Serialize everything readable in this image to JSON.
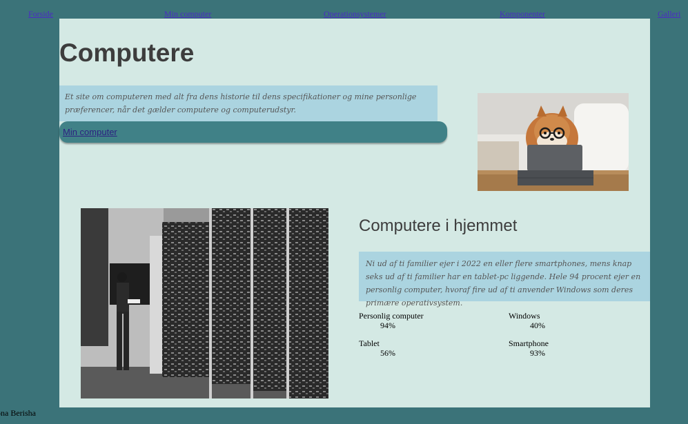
{
  "nav": {
    "items": [
      "Forside",
      "Min computer",
      "Operationsystemer",
      "Komponenter",
      "Galleri"
    ]
  },
  "header": {
    "title": "Computere",
    "intro": "Et site om computeren med alt fra dens historie til dens specifikationer og mine personlige præferencer, når det gælder computere og computerudstyr.",
    "link": "Min computer"
  },
  "section": {
    "title": "Computere i hjemmet",
    "text": "Ni ud af ti familier ejer i 2022 en eller flere smartphones, mens knap seks ud af ti familier har en tablet-pc liggende. Hele 94 procent ejer en personlig computer, hvoraf fire ud af ti anvender Windows som deres primære operativsystem.",
    "stats": [
      {
        "label": "Personlig computer",
        "value": "94%"
      },
      {
        "label": "Windows",
        "value": "40%"
      },
      {
        "label": "Tablet",
        "value": "56%"
      },
      {
        "label": "Smartphone",
        "value": "93%"
      }
    ]
  },
  "footer": {
    "text": "ona Berisha"
  },
  "colors": {
    "background": "#3b7379",
    "panel": "#d4e9e4",
    "text_box": "#abd4e0",
    "pill": "#408187",
    "link": "#4b2bc4"
  }
}
